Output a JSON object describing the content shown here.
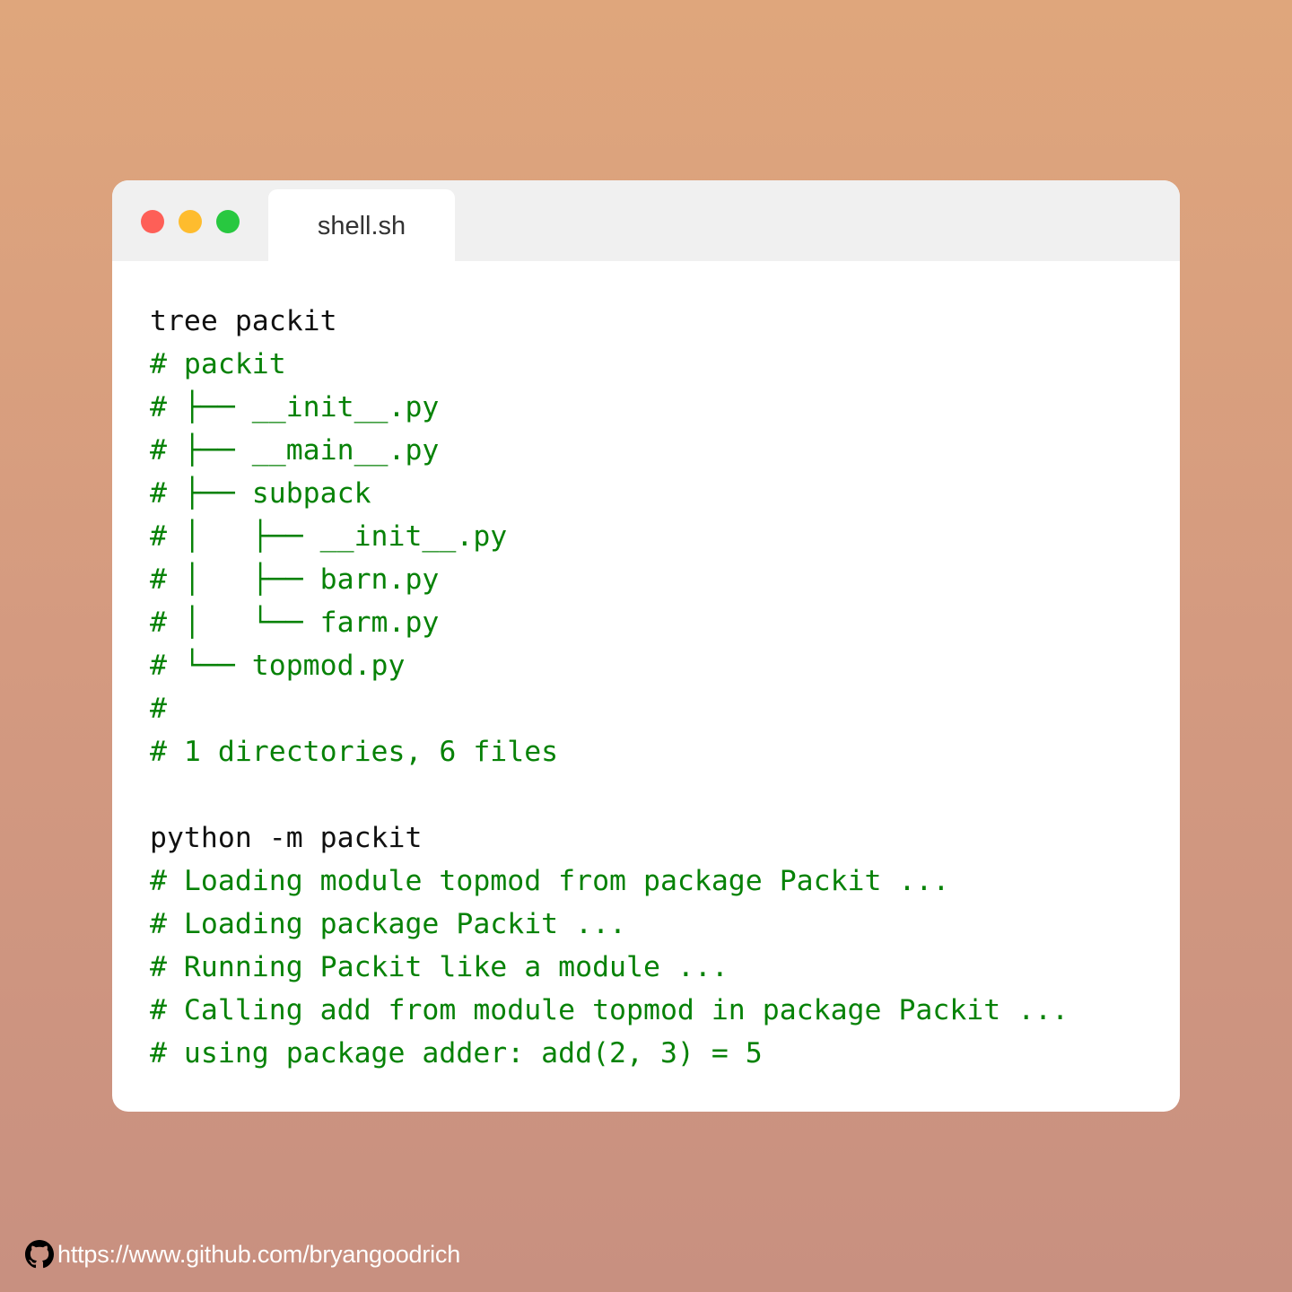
{
  "window": {
    "tab_title": "shell.sh",
    "controls": [
      "close",
      "minimize",
      "maximize"
    ]
  },
  "code_lines": [
    {
      "kind": "cmd",
      "text": "tree packit"
    },
    {
      "kind": "comment",
      "text": "# packit"
    },
    {
      "kind": "comment",
      "text": "# ├── __init__.py"
    },
    {
      "kind": "comment",
      "text": "# ├── __main__.py"
    },
    {
      "kind": "comment",
      "text": "# ├── subpack"
    },
    {
      "kind": "comment",
      "text": "# │   ├── __init__.py"
    },
    {
      "kind": "comment",
      "text": "# │   ├── barn.py"
    },
    {
      "kind": "comment",
      "text": "# │   └── farm.py"
    },
    {
      "kind": "comment",
      "text": "# └── topmod.py"
    },
    {
      "kind": "comment",
      "text": "#"
    },
    {
      "kind": "comment",
      "text": "# 1 directories, 6 files"
    },
    {
      "kind": "blank",
      "text": ""
    },
    {
      "kind": "cmd",
      "text": "python -m packit"
    },
    {
      "kind": "comment",
      "text": "# Loading module topmod from package Packit ..."
    },
    {
      "kind": "comment",
      "text": "# Loading package Packit ..."
    },
    {
      "kind": "comment",
      "text": "# Running Packit like a module ..."
    },
    {
      "kind": "comment",
      "text": "# Calling add from module topmod in package Packit ..."
    },
    {
      "kind": "comment",
      "text": "# using package adder: add(2, 3) = 5"
    }
  ],
  "footer": {
    "icon": "github-icon",
    "url": "https://www.github.com/bryangoodrich"
  },
  "colors": {
    "command_text": "#111111",
    "comment_text": "#078207",
    "close_dot": "#fe5f57",
    "minimize_dot": "#febc2e",
    "maximize_dot": "#28c840"
  }
}
